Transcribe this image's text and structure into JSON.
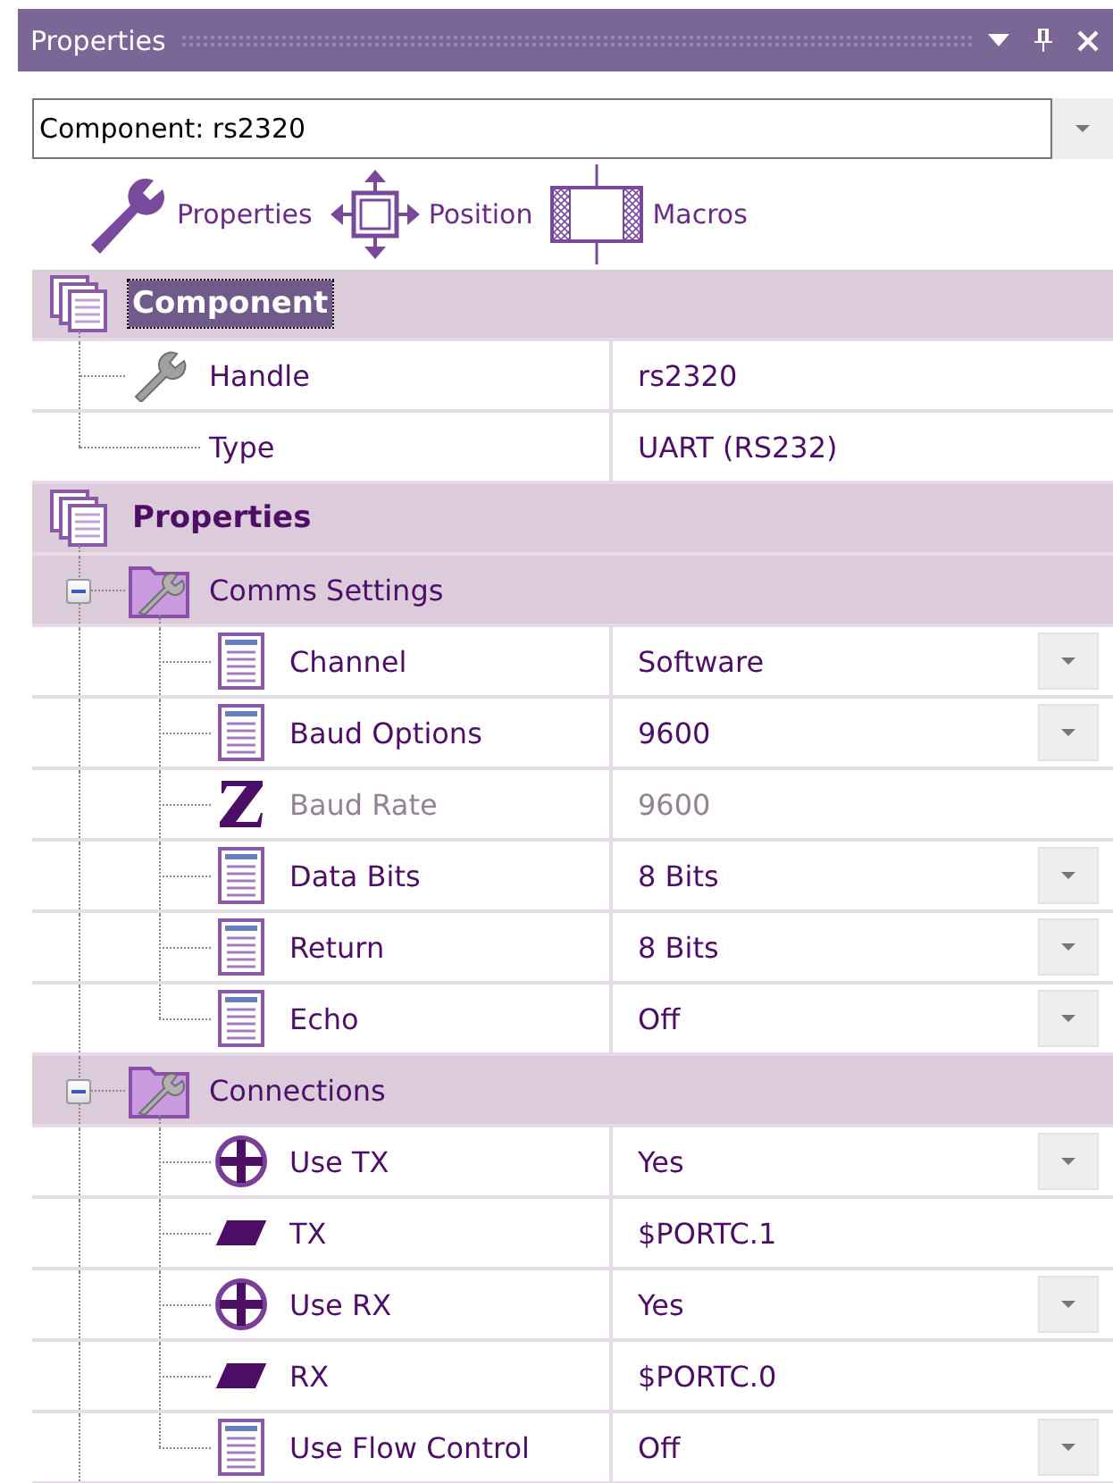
{
  "panel": {
    "title": "Properties"
  },
  "component_select": {
    "value": "Component: rs2320"
  },
  "toolbar": [
    {
      "label": "Properties",
      "kind": "wrench"
    },
    {
      "label": "Position",
      "kind": "move"
    },
    {
      "label": "Macros",
      "kind": "macro"
    }
  ],
  "sections": [
    {
      "title": "Component",
      "selected": true,
      "items": [
        {
          "label": "Handle",
          "value": "rs2320",
          "kind": "wrench",
          "dropdown": false,
          "disabled": false
        },
        {
          "label": "Type",
          "value": "UART (RS232)",
          "kind": "plain",
          "dropdown": false,
          "disabled": false
        }
      ]
    },
    {
      "title": "Properties",
      "selected": false,
      "groups": [
        {
          "title": "Comms Settings",
          "expanded": true,
          "items": [
            {
              "label": "Channel",
              "value": "Software",
              "kind": "list",
              "dropdown": true,
              "disabled": false
            },
            {
              "label": "Baud Options",
              "value": "9600",
              "kind": "list",
              "dropdown": true,
              "disabled": false
            },
            {
              "label": "Baud Rate",
              "value": "9600",
              "kind": "z",
              "dropdown": false,
              "disabled": true
            },
            {
              "label": "Data Bits",
              "value": "8 Bits",
              "kind": "list",
              "dropdown": true,
              "disabled": false
            },
            {
              "label": "Return",
              "value": "8 Bits",
              "kind": "list",
              "dropdown": true,
              "disabled": false
            },
            {
              "label": "Echo",
              "value": "Off",
              "kind": "list",
              "dropdown": true,
              "disabled": false
            }
          ]
        },
        {
          "title": "Connections",
          "expanded": true,
          "items": [
            {
              "label": "Use TX",
              "value": "Yes",
              "kind": "toggle",
              "dropdown": true,
              "disabled": false
            },
            {
              "label": "TX",
              "value": "$PORTC.1",
              "kind": "pin",
              "dropdown": false,
              "disabled": false
            },
            {
              "label": "Use RX",
              "value": "Yes",
              "kind": "toggle",
              "dropdown": true,
              "disabled": false
            },
            {
              "label": "RX",
              "value": "$PORTC.0",
              "kind": "pin",
              "dropdown": false,
              "disabled": false
            },
            {
              "label": "Use Flow Control",
              "value": "Off",
              "kind": "list",
              "dropdown": true,
              "disabled": false
            }
          ]
        }
      ]
    }
  ]
}
